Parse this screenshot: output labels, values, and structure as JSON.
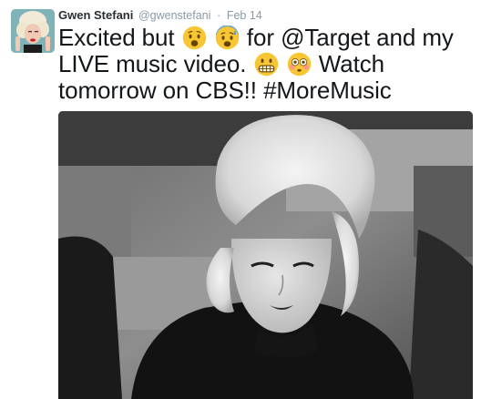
{
  "tweet": {
    "author_name": "Gwen Stefani",
    "author_handle": "@gwenstefani",
    "separator": "·",
    "date": "Feb 14",
    "text_part1": "Excited but",
    "text_part2": "for",
    "mention": "@Target",
    "text_part3": "and my LIVE music video.",
    "text_part4": "Watch tomorrow on CBS!!",
    "hashtag": "#MoreMusic",
    "emojis": [
      "frowning-open-mouth-emoji",
      "anxious-sweat-emoji",
      "grimacing-emoji",
      "flushed-emoji"
    ]
  },
  "colors": {
    "name": "#292f33",
    "meta": "#8899a6",
    "text": "#14171a",
    "emoji_yellow": "#f7c634",
    "emoji_blue": "#5c9ad6"
  }
}
